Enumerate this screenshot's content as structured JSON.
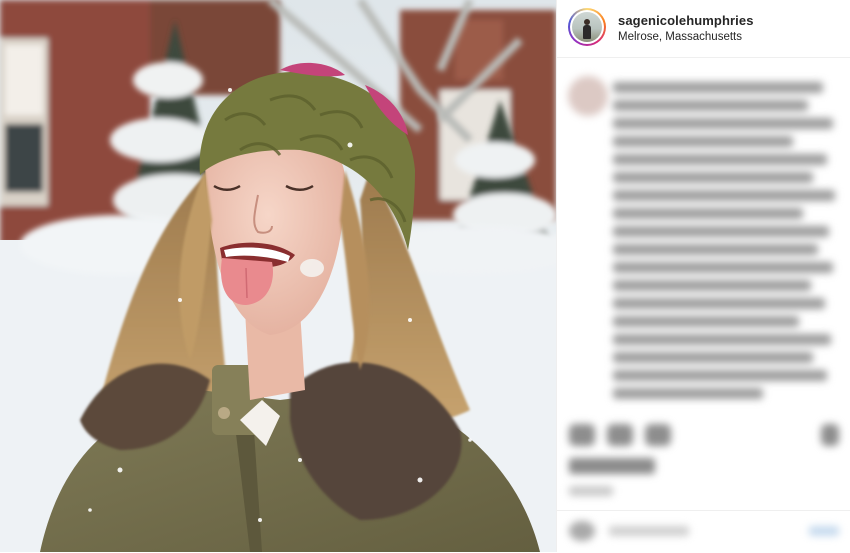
{
  "post": {
    "username": "sagenicolehumphries",
    "location": "Melrose, Massachusetts"
  },
  "photo": {
    "subject": "woman-in-knit-hat-catching-snowflakes",
    "colors": {
      "snow": "#eef2f5",
      "brick": "#8e4a3d",
      "hat": "#767a3e",
      "hat_accent": "#c4447a",
      "hair": "#b38d5c",
      "jacket": "#7a7452",
      "fur": "#5b4a3b",
      "skin": "#f0c9ba",
      "tongue": "#e98a8e"
    }
  },
  "ui": {
    "border": "#efefef",
    "text": "#262626",
    "story_ring": [
      "#feda75",
      "#fa7e1e",
      "#d62976",
      "#962fbf",
      "#4f5bd5"
    ],
    "blurred_text": "#9c9c9c"
  },
  "icons": {
    "like": "heart-icon",
    "comment": "comment-icon",
    "share": "paper-plane-icon",
    "save": "bookmark-icon",
    "emoji": "smiley-icon"
  }
}
